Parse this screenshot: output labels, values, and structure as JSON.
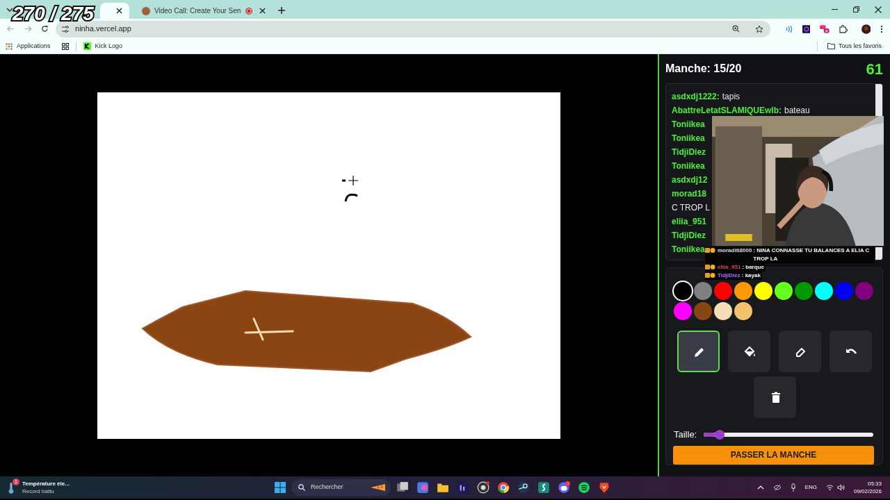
{
  "stream_overlay": {
    "counter": "270 / 275"
  },
  "browser": {
    "tabs": [
      {
        "selected": true
      },
      {
        "label": "Video Call: Create Your Sen",
        "selected": false,
        "recording": true
      }
    ],
    "address": "ninha.vercel.app",
    "bookmarks": [
      "Applications",
      "Kick Logo"
    ],
    "all_bookmarks": "Tous les favoris"
  },
  "game": {
    "round": "Manche: 15/20",
    "timer": "61",
    "chat": [
      {
        "user": "asdxdj1222:",
        "text": "tapis"
      },
      {
        "user": "AbattreLetatSLAMIQUEwlb:",
        "text": "bateau"
      },
      {
        "user": "Toniikea"
      },
      {
        "user": "Toniikea"
      },
      {
        "user": "TidjiDiez"
      },
      {
        "user": "Toniikea"
      },
      {
        "user": "asdxdj12"
      },
      {
        "user": "morad18"
      },
      {
        "text": "C TROP L"
      },
      {
        "user": "eliia_951"
      },
      {
        "user": "TidjiDiez"
      },
      {
        "user": "Toniikea"
      }
    ],
    "stream_chat": [
      {
        "user": "moraditi8000",
        "text": ": NINA CONNASSE TU BALANCES A ELIA C TROP LA",
        "color": "#e0e0e0"
      },
      {
        "user": "eliia_951",
        "text": ": barque",
        "color": "#e04060"
      },
      {
        "user": "TidjiDiez",
        "text": ": kayak",
        "color": "#b070ff"
      }
    ],
    "colors": [
      {
        "color": "#000000",
        "selected": true
      },
      {
        "color": "#808080",
        "selected": false
      },
      {
        "color": "#ff0000",
        "selected": false
      },
      {
        "color": "#ff9900",
        "selected": false
      },
      {
        "color": "#ffff00",
        "selected": false
      },
      {
        "color": "#66ff22",
        "selected": false
      },
      {
        "color": "#009900",
        "selected": false
      },
      {
        "color": "#00ffff",
        "selected": false
      },
      {
        "color": "#0000ff",
        "selected": false
      },
      {
        "color": "#800080",
        "selected": false
      },
      {
        "color": "#ff00ff",
        "selected": false
      },
      {
        "color": "#8b4513",
        "selected": false
      },
      {
        "color": "#f5deb3",
        "selected": false
      },
      {
        "color": "#f4c26b",
        "selected": false
      }
    ],
    "tools": [
      {
        "kind": "pencil",
        "selected": true
      },
      {
        "kind": "fill",
        "selected": false
      },
      {
        "kind": "eraser",
        "selected": false
      },
      {
        "kind": "undo",
        "selected": false
      },
      {
        "kind": "clear",
        "selected": false
      }
    ],
    "size": {
      "label": "Taille:",
      "level": 0.07
    },
    "skip_button": "PASSER LA MANCHE"
  },
  "taskbar": {
    "widget": {
      "title": "Température éle...",
      "subtitle": "Record battu",
      "badge": "1"
    },
    "search": "Rechercher",
    "language": "ENG",
    "time": "05:33",
    "date": "09/02/2026"
  }
}
